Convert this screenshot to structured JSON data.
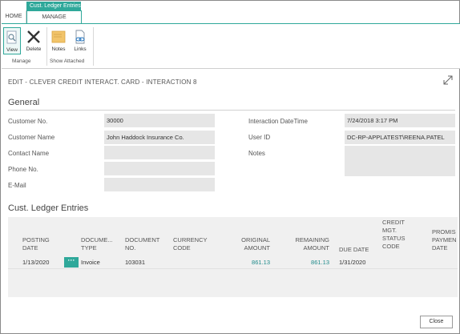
{
  "ribbon": {
    "context_header": "Cust. Ledger Entries",
    "tabs": [
      {
        "label": "HOME"
      },
      {
        "label": "MANAGE"
      }
    ],
    "buttons": {
      "view": "View",
      "delete": "Delete",
      "notes": "Notes",
      "links": "Links"
    },
    "groups": {
      "manage": "Manage",
      "show_attached": "Show Attached"
    }
  },
  "page": {
    "title": "EDIT - CLEVER CREDIT INTERACT. CARD - INTERACTION 8"
  },
  "general": {
    "section_title": "General",
    "customer_no": {
      "label": "Customer No.",
      "value": "30000"
    },
    "customer_name": {
      "label": "Customer Name",
      "value": "John Haddock Insurance Co."
    },
    "contact_name": {
      "label": "Contact Name",
      "value": ""
    },
    "phone_no": {
      "label": "Phone No.",
      "value": ""
    },
    "email": {
      "label": "E-Mail",
      "value": ""
    },
    "interaction_datetime": {
      "label": "Interaction DateTime",
      "value": "7/24/2018 3:17 PM"
    },
    "user_id": {
      "label": "User ID",
      "value": "DC-RP-APPLATEST\\REENA.PATEL"
    },
    "notes": {
      "label": "Notes",
      "value": ""
    }
  },
  "ledger": {
    "section_title": "Cust. Ledger Entries",
    "headers": {
      "posting_date": [
        "POSTING",
        "DATE"
      ],
      "document_type": [
        "DOCUME...",
        "TYPE"
      ],
      "document_no": [
        "DOCUMENT",
        "NO."
      ],
      "currency_code": [
        "CURRENCY",
        "CODE"
      ],
      "original_amount": [
        "ORIGINAL",
        "AMOUNT"
      ],
      "remaining_amount": [
        "REMAINING",
        "AMOUNT"
      ],
      "due_date": [
        "DUE DATE"
      ],
      "credit_status": [
        "CREDIT",
        "MGT.",
        "STATUS",
        "CODE"
      ],
      "promised_payment": [
        "PROMIS",
        "PAYMEN",
        "DATE"
      ]
    },
    "rows": [
      {
        "posting_date": "1/13/2020",
        "row_menu": "···",
        "document_type": "Invoice",
        "document_no": "103031",
        "currency_code": "",
        "original_amount": "861.13",
        "remaining_amount": "861.13",
        "due_date": "1/31/2020",
        "credit_status": "",
        "promised_payment": ""
      }
    ]
  },
  "footer": {
    "close_label": "Close"
  },
  "colors": {
    "accent": "#2fa89a",
    "field_bg": "#e6e6e6",
    "link": "#1f8a8a"
  }
}
